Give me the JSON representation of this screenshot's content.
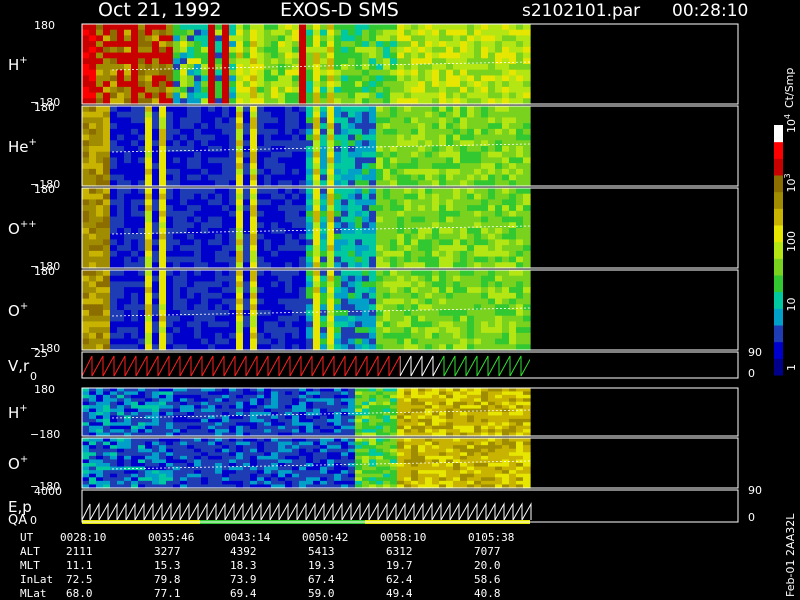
{
  "header": {
    "date": "Oct 21, 1992",
    "instrument": "EXOS-D SMS",
    "file": "s2102101.par",
    "time": "00:28:10"
  },
  "footer": {
    "row_labels": [
      "UT",
      "ALT",
      "MLT",
      "InLat",
      "MLat"
    ],
    "columns": [
      [
        "0028:10",
        "2111",
        "11.1",
        "72.5",
        "68.0"
      ],
      [
        "0035:46",
        "3277",
        "15.3",
        "79.8",
        "77.1"
      ],
      [
        "0043:14",
        "4392",
        "18.3",
        "73.9",
        "69.4"
      ],
      [
        "0050:42",
        "5413",
        "19.3",
        "67.4",
        "59.0"
      ],
      [
        "0058:10",
        "6312",
        "19.7",
        "62.4",
        "49.4"
      ],
      [
        "0105:38",
        "7077",
        "20.0",
        "58.6",
        "40.8"
      ]
    ],
    "side_note": "Feb-01 2AA32L"
  },
  "colorbar": {
    "label": "Ct/Smp",
    "ticks": [
      {
        "v": 1,
        "label": "1"
      },
      {
        "v": 10,
        "label": "10"
      },
      {
        "v": 100,
        "label": "100"
      },
      {
        "v": 1000,
        "label": "10",
        "exp": "3"
      },
      {
        "v": 10000,
        "label": "10",
        "exp": "4"
      }
    ],
    "colors": [
      "#00008b",
      "#0000cd",
      "#1e3cb4",
      "#00a0c8",
      "#00c8a0",
      "#32c832",
      "#78d21e",
      "#b4e614",
      "#e6e600",
      "#c8b400",
      "#a08c00",
      "#8c6e00",
      "#c80000",
      "#ff0000",
      "#ffffff"
    ]
  },
  "chart_data": {
    "type": "heatmap",
    "color_scale": "log",
    "color_range": [
      1,
      10000
    ],
    "panels": [
      {
        "label": "H",
        "sup": "+",
        "ylim": [
          -180,
          180
        ],
        "ticks": [
          "180",
          "−180"
        ]
      },
      {
        "label": "He",
        "sup": "+",
        "ylim": [
          -180,
          180
        ],
        "ticks": [
          "180",
          "−180"
        ]
      },
      {
        "label": "O",
        "sup": "++",
        "ylim": [
          -180,
          180
        ],
        "ticks": [
          "180",
          "−180"
        ]
      },
      {
        "label": "O",
        "sup": "+",
        "ylim": [
          -180,
          180
        ],
        "ticks": [
          "180",
          "−180"
        ]
      },
      {
        "label": "V,r",
        "sup": "",
        "ylim": [
          0,
          25
        ],
        "ticks": [
          "25",
          "0"
        ],
        "right_ticks": [
          "90",
          "0"
        ]
      },
      {
        "label": "H",
        "sup": "+",
        "ylim": [
          -180,
          180
        ],
        "ticks": [
          "180",
          "−180"
        ]
      },
      {
        "label": "O",
        "sup": "+",
        "ylim": [
          -180,
          180
        ],
        "ticks": [
          "",
          "−180"
        ]
      },
      {
        "label": "E,p",
        "label2": "QA",
        "ylim": [
          0,
          4000
        ],
        "ticks": [
          "4000",
          "0"
        ],
        "right_ticks": [
          "90",
          "0"
        ]
      }
    ],
    "x_tick_labels": [
      "0028:10",
      "0035:46",
      "0043:14",
      "0050:42",
      "0058:10",
      "0105:38"
    ]
  }
}
